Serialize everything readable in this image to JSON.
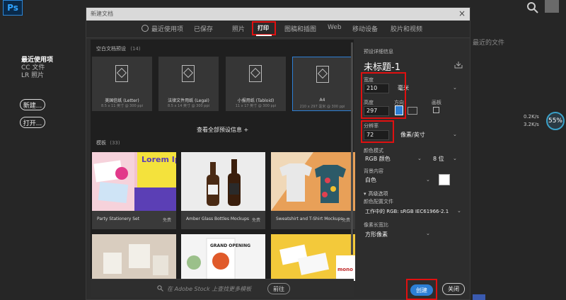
{
  "app": {
    "logo": "Ps"
  },
  "home": {
    "nav": [
      "最近使用项",
      "CC 文件",
      "LR 照片"
    ],
    "new_btn": "新建...",
    "open_btn": "打开...",
    "recent_hint": "最近的文件"
  },
  "net": {
    "up": "0.2K/s",
    "down": "3.2K/s",
    "percent": "55%"
  },
  "dialog": {
    "title": "新建文档",
    "close": "×",
    "tabs": [
      "最近使用项",
      "已保存",
      "照片",
      "打印",
      "图稿和插图",
      "Web",
      "移动设备",
      "胶片和视频"
    ],
    "selected_tab": "打印"
  },
  "presets": {
    "label": "空白文档预设",
    "count": "(14)",
    "items": [
      {
        "name": "美国信纸 (Letter)",
        "size": "8.5 x 11 英寸 @ 300 ppi"
      },
      {
        "name": "法律文件用纸 (Legal)",
        "size": "8.5 x 14 英寸 @ 300 ppi"
      },
      {
        "name": "小报用纸 (Tabloid)",
        "size": "11 x 17 英寸 @ 300 ppi"
      },
      {
        "name": "A4",
        "size": "210 x 297 毫米 @ 300 ppi"
      }
    ],
    "view_all": "查看全部预设信息 +"
  },
  "templates": {
    "label": "模板",
    "count": "(33)",
    "items": [
      {
        "caption": "Party Stationery Set",
        "badge": "免费",
        "art": "Lorem Ipsum"
      },
      {
        "caption": "Amber Glass Bottles Mockups",
        "badge": "免费"
      },
      {
        "caption": "Sweatshirt and T-Shirt Mockups",
        "badge": "免费"
      }
    ],
    "row2_text": [
      "GRAND OPENING",
      "mono"
    ],
    "search_placeholder": "在 Adobe Stock 上查找更多模板",
    "go": "前往"
  },
  "details": {
    "header": "预设详细信息",
    "doc_name": "未标题-1",
    "width_label": "宽度",
    "width": "210",
    "width_unit": "毫米",
    "height_label": "高度",
    "height": "297",
    "orientation_label": "方向",
    "artboard_label": "画板",
    "resolution_label": "分辨率",
    "resolution": "72",
    "resolution_unit": "像素/英寸",
    "color_mode_label": "颜色模式",
    "color_mode": "RGB 颜色",
    "bit_depth": "8 位",
    "bg_label": "背景内容",
    "bg": "白色",
    "advanced": "高级选项",
    "profile_label": "颜色配置文件",
    "profile": "工作中的 RGB: sRGB IEC61966-2.1",
    "pixel_label": "像素长宽比",
    "pixel": "方形像素",
    "create": "创建",
    "close_btn": "关闭"
  }
}
